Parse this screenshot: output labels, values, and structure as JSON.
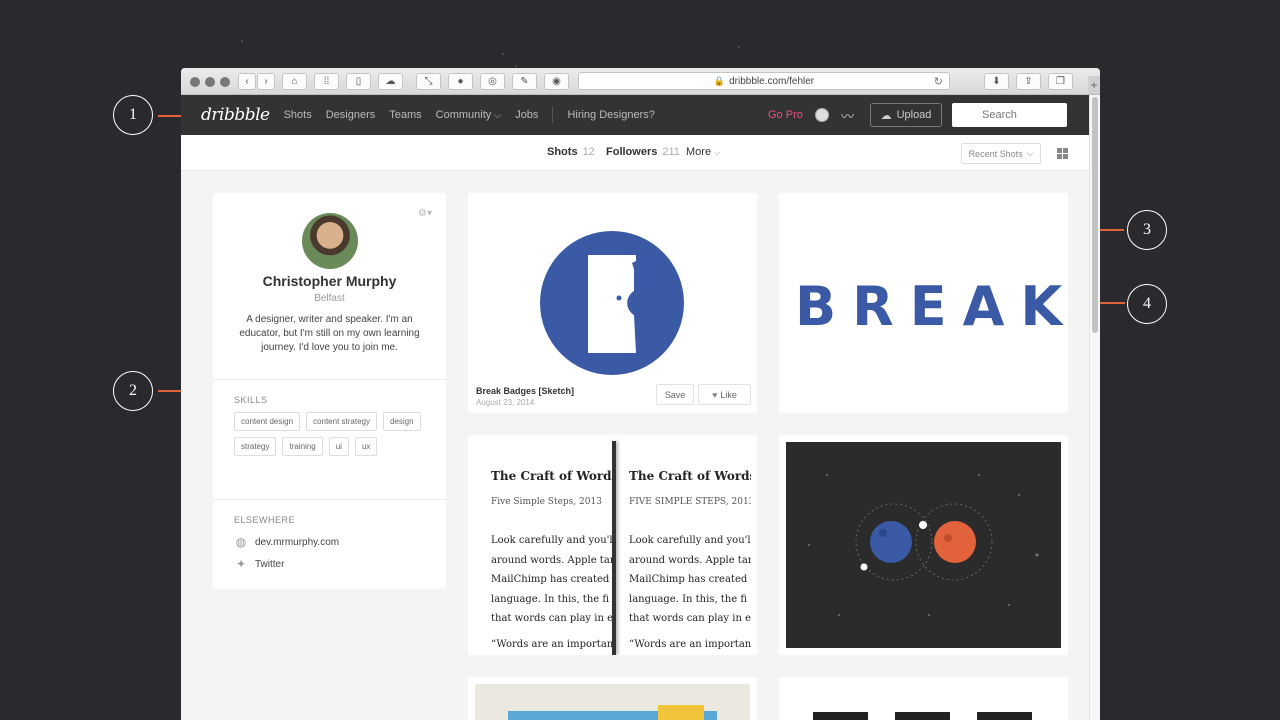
{
  "browser": {
    "url": "dribbble.com/fehler"
  },
  "nav": {
    "logo": "dribbble",
    "links": [
      "Shots",
      "Designers",
      "Teams",
      "Community",
      "Jobs"
    ],
    "community_caret": "⌵",
    "hiring": "Hiring Designers?",
    "go_pro": "Go Pro",
    "upload_label": "Upload",
    "search_placeholder": "Search"
  },
  "subnav": {
    "tabs": [
      {
        "label": "Shots",
        "count": "12"
      },
      {
        "label": "Followers",
        "count": "211"
      },
      {
        "label": "More",
        "count": ""
      }
    ],
    "sort_label": "Recent Shots"
  },
  "profile": {
    "name": "Christopher Murphy",
    "location": "Belfast",
    "bio": "A designer, writer and speaker. I'm an educator, but I'm still on my own learning journey. I'd love you to join me.",
    "skills_heading": "SKILLS",
    "skills": [
      "content design",
      "content strategy",
      "design",
      "strategy",
      "training",
      "ui",
      "ux"
    ],
    "elsewhere_heading": "ELSEWHERE",
    "links": [
      {
        "label": "dev.mrmurphy.com",
        "icon": "globe-icon"
      },
      {
        "label": "Twitter",
        "icon": "twitter-icon"
      }
    ]
  },
  "shots": {
    "first": {
      "title": "Break Badges [Sketch]",
      "date": "August 23, 2014",
      "save_label": "Save",
      "like_label": "Like"
    },
    "break_text": "BREAK",
    "craft": {
      "heading": "The Craft of Words,",
      "sub_left": "Five Simple Steps, 2013",
      "sub_right": "FIVE SIMPLE STEPS, 2013",
      "lines": [
        "Look carefully and you'l",
        "around words. Apple tar",
        "MailChimp has created",
        "language. In this, the fi",
        "that words can play in e"
      ],
      "quote": "“Words are an importan"
    }
  },
  "callouts": [
    "1",
    "2",
    "3",
    "4"
  ],
  "colors": {
    "accent": "#e2623c",
    "brand_blue": "#3b5aa6",
    "go_pro": "#ea4c89"
  }
}
